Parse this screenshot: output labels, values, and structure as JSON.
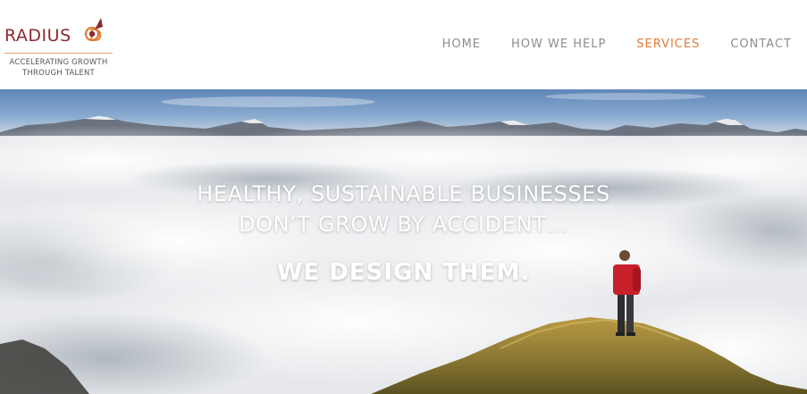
{
  "brand": {
    "wordmark": "RADIUS",
    "wordmark_tail": "D",
    "tagline_line1": "ACCELERATING GROWTH",
    "tagline_line2": "THROUGH TALENT",
    "colors": {
      "wordmark": "#8b2a2f",
      "accent": "#e07b35",
      "rule": "#e0a27a"
    }
  },
  "nav": {
    "items": [
      {
        "label": "HOME",
        "active": false
      },
      {
        "label": "HOW WE HELP",
        "active": false
      },
      {
        "label": "SERVICES",
        "active": true
      },
      {
        "label": "CONTACT",
        "active": false
      }
    ],
    "colors": {
      "default": "#8d8d8d",
      "active": "#e07b35"
    }
  },
  "hero": {
    "headline_line1": "HEALTHY, SUSTAINABLE BUSINESSES",
    "headline_line2": "DON’T GROW BY ACCIDENT…",
    "subheadline": "WE DESIGN THEM.",
    "image": "hiker-on-summit-above-sea-of-clouds"
  }
}
